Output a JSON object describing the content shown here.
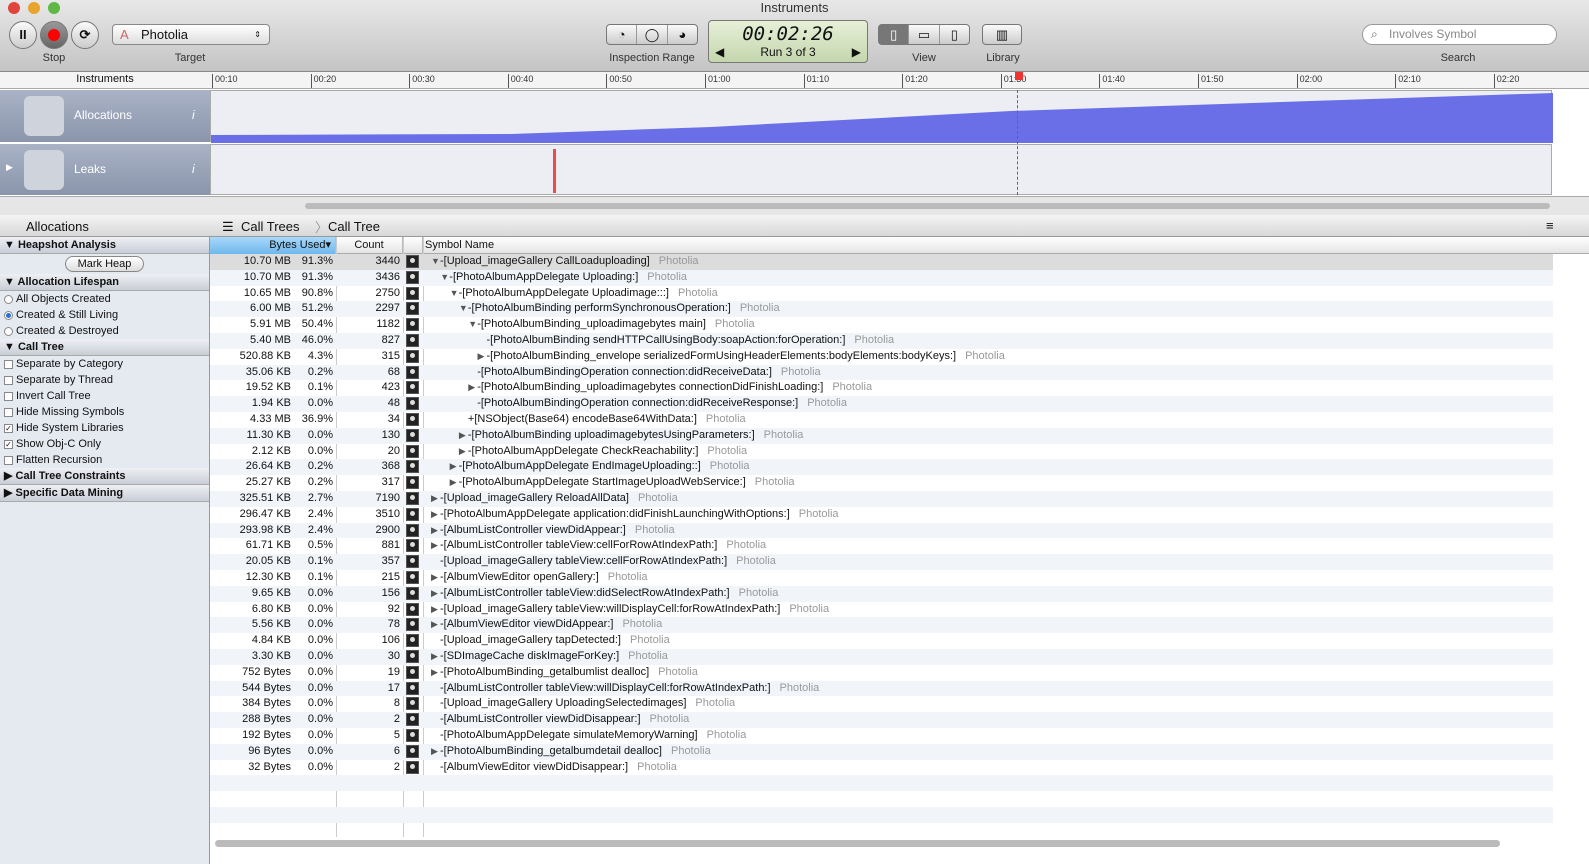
{
  "window": {
    "title": "Instruments"
  },
  "toolbar": {
    "stop_label": "Stop",
    "target_label": "Target",
    "target_value": "Photolia",
    "inspection_label": "Inspection Range",
    "timer": "00:02:26",
    "run": "Run 3 of 3",
    "view_label": "View",
    "library_label": "Library",
    "search_placeholder": "Involves Symbol",
    "search_label": "Search"
  },
  "ruler": {
    "title": "Instruments",
    "ticks": [
      "00:10",
      "00:20",
      "00:30",
      "00:40",
      "00:50",
      "01:00",
      "01:10",
      "01:20",
      "01:30",
      "01:40",
      "01:50",
      "02:00",
      "02:10",
      "02:20"
    ]
  },
  "tracks": [
    {
      "name": "Allocations"
    },
    {
      "name": "Leaks"
    }
  ],
  "colors": {
    "allocations_fill": "#6a6fe8",
    "leak_marker": "#e84c4c",
    "selection_header": "#7fc4f0"
  },
  "breadcrumb": {
    "instrument": "Allocations",
    "items": [
      "Call Trees",
      "Call Tree"
    ]
  },
  "sidebar": {
    "heapshot": "Heapshot Analysis",
    "mark_heap": "Mark Heap",
    "lifespan": "Allocation Lifespan",
    "lifespan_options": [
      {
        "label": "All Objects Created",
        "selected": false
      },
      {
        "label": "Created & Still Living",
        "selected": true
      },
      {
        "label": "Created & Destroyed",
        "selected": false
      }
    ],
    "call_tree": "Call Tree",
    "call_tree_options": [
      {
        "label": "Separate by Category",
        "checked": false
      },
      {
        "label": "Separate by Thread",
        "checked": false
      },
      {
        "label": "Invert Call Tree",
        "checked": false
      },
      {
        "label": "Hide Missing Symbols",
        "checked": false
      },
      {
        "label": "Hide System Libraries",
        "checked": true
      },
      {
        "label": "Show Obj-C Only",
        "checked": true
      },
      {
        "label": "Flatten Recursion",
        "checked": false
      }
    ],
    "constraints": "Call Tree Constraints",
    "data_mining": "Specific Data Mining"
  },
  "table": {
    "columns": {
      "bytes": "Bytes Used",
      "count": "Count",
      "symbol": "Symbol Name"
    },
    "library": "Photolia",
    "rows": [
      {
        "bytes": "10.70 MB",
        "pct": "91.3%",
        "count": "3440",
        "depth": 0,
        "toggle": "open",
        "symbol": "-[Upload_imageGallery CallLoaduploading]"
      },
      {
        "bytes": "10.70 MB",
        "pct": "91.3%",
        "count": "3436",
        "depth": 1,
        "toggle": "open",
        "symbol": "-[PhotoAlbumAppDelegate Uploading:]"
      },
      {
        "bytes": "10.65 MB",
        "pct": "90.8%",
        "count": "2750",
        "depth": 2,
        "toggle": "open",
        "symbol": "-[PhotoAlbumAppDelegate Uploadimage:::]"
      },
      {
        "bytes": "6.00 MB",
        "pct": "51.2%",
        "count": "2297",
        "depth": 3,
        "toggle": "open",
        "symbol": "-[PhotoAlbumBinding performSynchronousOperation:]"
      },
      {
        "bytes": "5.91 MB",
        "pct": "50.4%",
        "count": "1182",
        "depth": 4,
        "toggle": "open",
        "symbol": "-[PhotoAlbumBinding_uploadimagebytes main]"
      },
      {
        "bytes": "5.40 MB",
        "pct": "46.0%",
        "count": "827",
        "depth": 5,
        "toggle": "none",
        "symbol": "-[PhotoAlbumBinding sendHTTPCallUsingBody:soapAction:forOperation:]"
      },
      {
        "bytes": "520.88 KB",
        "pct": "4.3%",
        "count": "315",
        "depth": 5,
        "toggle": "closed",
        "symbol": "-[PhotoAlbumBinding_envelope serializedFormUsingHeaderElements:bodyElements:bodyKeys:]"
      },
      {
        "bytes": "35.06 KB",
        "pct": "0.2%",
        "count": "68",
        "depth": 4,
        "toggle": "none",
        "symbol": "-[PhotoAlbumBindingOperation connection:didReceiveData:]"
      },
      {
        "bytes": "19.52 KB",
        "pct": "0.1%",
        "count": "423",
        "depth": 4,
        "toggle": "closed",
        "symbol": "-[PhotoAlbumBinding_uploadimagebytes connectionDidFinishLoading:]"
      },
      {
        "bytes": "1.94 KB",
        "pct": "0.0%",
        "count": "48",
        "depth": 4,
        "toggle": "none",
        "symbol": "-[PhotoAlbumBindingOperation connection:didReceiveResponse:]"
      },
      {
        "bytes": "4.33 MB",
        "pct": "36.9%",
        "count": "34",
        "depth": 3,
        "toggle": "none",
        "symbol": "+[NSObject(Base64) encodeBase64WithData:]"
      },
      {
        "bytes": "11.30 KB",
        "pct": "0.0%",
        "count": "130",
        "depth": 3,
        "toggle": "closed",
        "symbol": "-[PhotoAlbumBinding uploadimagebytesUsingParameters:]"
      },
      {
        "bytes": "2.12 KB",
        "pct": "0.0%",
        "count": "20",
        "depth": 3,
        "toggle": "closed",
        "symbol": "-[PhotoAlbumAppDelegate CheckReachability:]"
      },
      {
        "bytes": "26.64 KB",
        "pct": "0.2%",
        "count": "368",
        "depth": 2,
        "toggle": "closed",
        "symbol": "-[PhotoAlbumAppDelegate EndImageUploading::]"
      },
      {
        "bytes": "25.27 KB",
        "pct": "0.2%",
        "count": "317",
        "depth": 2,
        "toggle": "closed",
        "symbol": "-[PhotoAlbumAppDelegate StartImageUploadWebService:]"
      },
      {
        "bytes": "325.51 KB",
        "pct": "2.7%",
        "count": "7190",
        "depth": 0,
        "toggle": "closed",
        "symbol": "-[Upload_imageGallery ReloadAllData]"
      },
      {
        "bytes": "296.47 KB",
        "pct": "2.4%",
        "count": "3510",
        "depth": 0,
        "toggle": "closed",
        "symbol": "-[PhotoAlbumAppDelegate application:didFinishLaunchingWithOptions:]"
      },
      {
        "bytes": "293.98 KB",
        "pct": "2.4%",
        "count": "2900",
        "depth": 0,
        "toggle": "closed",
        "symbol": "-[AlbumListController viewDidAppear:]"
      },
      {
        "bytes": "61.71 KB",
        "pct": "0.5%",
        "count": "881",
        "depth": 0,
        "toggle": "closed",
        "symbol": "-[AlbumListController tableView:cellForRowAtIndexPath:]"
      },
      {
        "bytes": "20.05 KB",
        "pct": "0.1%",
        "count": "357",
        "depth": 0,
        "toggle": "none",
        "symbol": "-[Upload_imageGallery tableView:cellForRowAtIndexPath:]"
      },
      {
        "bytes": "12.30 KB",
        "pct": "0.1%",
        "count": "215",
        "depth": 0,
        "toggle": "closed",
        "symbol": "-[AlbumViewEditor openGallery:]"
      },
      {
        "bytes": "9.65 KB",
        "pct": "0.0%",
        "count": "156",
        "depth": 0,
        "toggle": "closed",
        "symbol": "-[AlbumListController tableView:didSelectRowAtIndexPath:]"
      },
      {
        "bytes": "6.80 KB",
        "pct": "0.0%",
        "count": "92",
        "depth": 0,
        "toggle": "closed",
        "symbol": "-[Upload_imageGallery tableView:willDisplayCell:forRowAtIndexPath:]"
      },
      {
        "bytes": "5.56 KB",
        "pct": "0.0%",
        "count": "78",
        "depth": 0,
        "toggle": "closed",
        "symbol": "-[AlbumViewEditor viewDidAppear:]"
      },
      {
        "bytes": "4.84 KB",
        "pct": "0.0%",
        "count": "106",
        "depth": 0,
        "toggle": "none",
        "symbol": "-[Upload_imageGallery tapDetected:]"
      },
      {
        "bytes": "3.30 KB",
        "pct": "0.0%",
        "count": "30",
        "depth": 0,
        "toggle": "closed",
        "symbol": "-[SDImageCache diskImageForKey:]"
      },
      {
        "bytes": "752 Bytes",
        "pct": "0.0%",
        "count": "19",
        "depth": 0,
        "toggle": "closed",
        "symbol": "-[PhotoAlbumBinding_getalbumlist dealloc]"
      },
      {
        "bytes": "544 Bytes",
        "pct": "0.0%",
        "count": "17",
        "depth": 0,
        "toggle": "none",
        "symbol": "-[AlbumListController tableView:willDisplayCell:forRowAtIndexPath:]"
      },
      {
        "bytes": "384 Bytes",
        "pct": "0.0%",
        "count": "8",
        "depth": 0,
        "toggle": "none",
        "symbol": "-[Upload_imageGallery UploadingSelectedimages]"
      },
      {
        "bytes": "288 Bytes",
        "pct": "0.0%",
        "count": "2",
        "depth": 0,
        "toggle": "none",
        "symbol": "-[AlbumListController viewDidDisappear:]"
      },
      {
        "bytes": "192 Bytes",
        "pct": "0.0%",
        "count": "5",
        "depth": 0,
        "toggle": "none",
        "symbol": "-[PhotoAlbumAppDelegate simulateMemoryWarning]"
      },
      {
        "bytes": "96 Bytes",
        "pct": "0.0%",
        "count": "6",
        "depth": 0,
        "toggle": "closed",
        "symbol": "-[PhotoAlbumBinding_getalbumdetail dealloc]"
      },
      {
        "bytes": "32 Bytes",
        "pct": "0.0%",
        "count": "2",
        "depth": 0,
        "toggle": "none",
        "symbol": "-[AlbumViewEditor viewDidDisappear:]"
      }
    ]
  }
}
